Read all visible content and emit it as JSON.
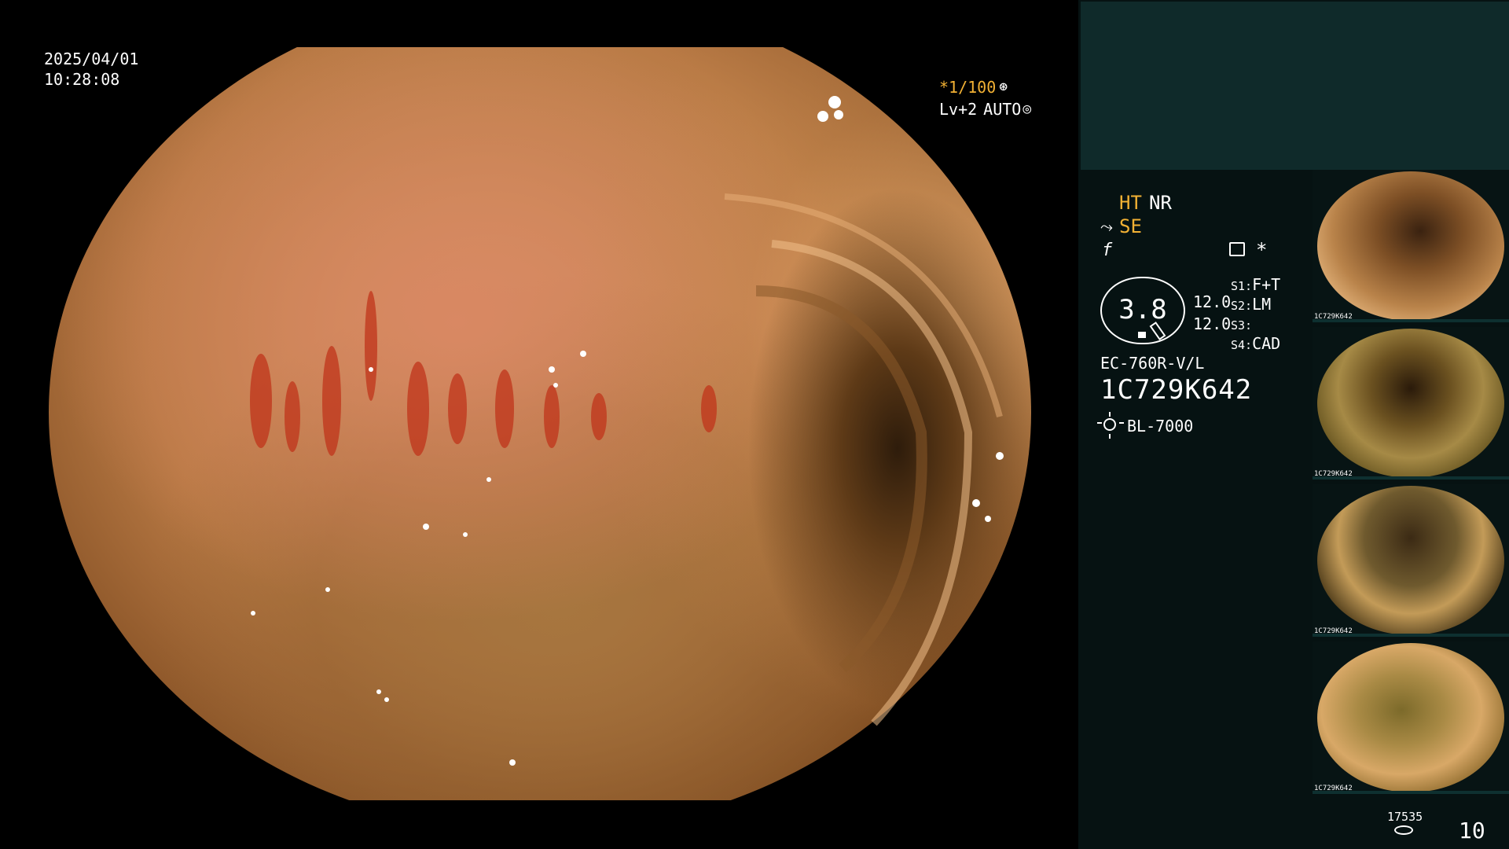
{
  "overlay": {
    "date": "2025/04/01",
    "time": "10:28:08",
    "shutter": "*1/100",
    "shutter_icon": "⊛",
    "level": "Lv+2",
    "mode": "AUTO",
    "mode_icon": "◎",
    "accent_color": "#f2b134"
  },
  "panel": {
    "ht": "HT",
    "nr": "NR",
    "se_icon": "⤳",
    "se": "SE",
    "f_icon": "f",
    "asterisk": "*",
    "zoom": "3.8",
    "value_a": "12.0",
    "value_b": "12.0",
    "slots": [
      {
        "key": "S1:",
        "value": "F+T"
      },
      {
        "key": "S2:",
        "value": "LM"
      },
      {
        "key": "S3:",
        "value": ""
      },
      {
        "key": "S4:",
        "value": "CAD"
      }
    ],
    "model": "EC-760R-V/L",
    "serial": "1C729K642",
    "light_source": "BL-7000"
  },
  "thumbnails": [
    {
      "caption": "1C729K642"
    },
    {
      "caption": "1C729K642"
    },
    {
      "caption": "1C729K642"
    },
    {
      "caption": "1C729K642"
    }
  ],
  "storage": {
    "count": "17535",
    "frames": "10"
  }
}
